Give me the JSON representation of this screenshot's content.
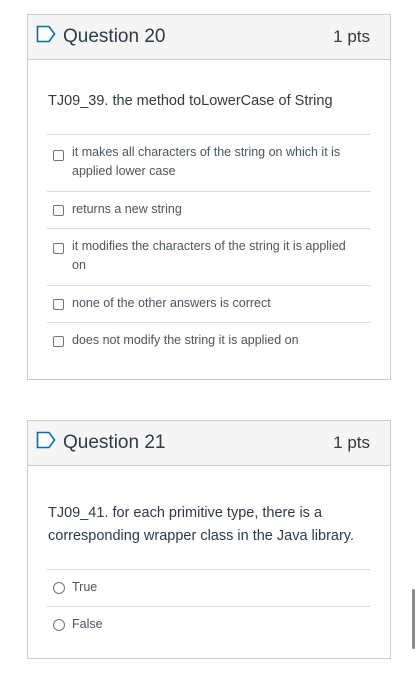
{
  "questions": [
    {
      "title": "Question 20",
      "points": "1 pts",
      "prompt": "TJ09_39.  the method toLowerCase of String",
      "answer_type": "checkbox",
      "answers": [
        "it makes all characters of the string on which it is applied lower case",
        "returns a new string",
        "it modifies the characters of the string it is applied on",
        "none of the other answers is correct",
        "does not modify the string it is applied on"
      ]
    },
    {
      "title": "Question 21",
      "points": "1 pts",
      "prompt": "TJ09_41. for each primitive type, there is a corresponding wrapper class in the Java library.",
      "answer_type": "radio",
      "answers": [
        "True",
        "False"
      ]
    }
  ],
  "icons": {
    "flag": "flag-outline-icon"
  },
  "colors": {
    "accent": "#0770a3",
    "text": "#2d3b45",
    "border": "#c7cdd1",
    "header_bg": "#f5f5f5"
  }
}
